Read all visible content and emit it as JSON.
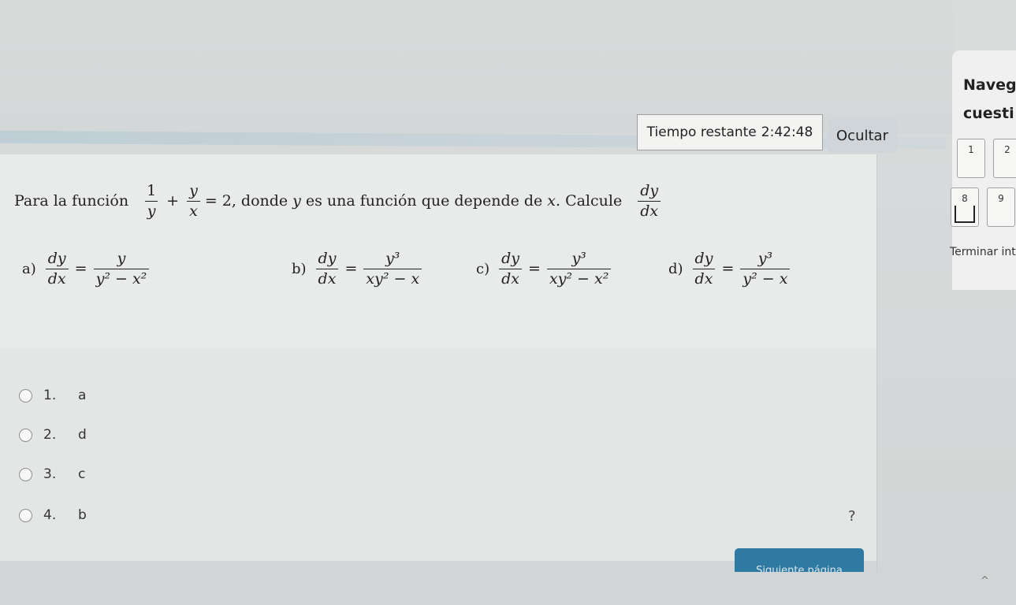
{
  "timer": {
    "label": "Tiempo restante",
    "value": "2:42:48"
  },
  "hide_button": "Ocultar",
  "question": {
    "prefix": "Para la función",
    "eq_f1_num": "1",
    "eq_f1_den": "y",
    "eq_plus": "+",
    "eq_f2_num": "y",
    "eq_f2_den": "x",
    "eq_rhs": "= 2,",
    "mid": "donde",
    "var_y": "y",
    "mid2": "es una función que depende de",
    "var_x": "x.",
    "ask": "Calcule",
    "d_num": "dy",
    "d_den": "dx"
  },
  "options": [
    {
      "label": "a)",
      "lhs_num": "dy",
      "lhs_den": "dx",
      "eq": "=",
      "rhs_num": "y",
      "rhs_den": "y² − x²"
    },
    {
      "label": "b)",
      "lhs_num": "dy",
      "lhs_den": "dx",
      "eq": "=",
      "rhs_num": "y³",
      "rhs_den": "xy² − x"
    },
    {
      "label": "c)",
      "lhs_num": "dy",
      "lhs_den": "dx",
      "eq": "=",
      "rhs_num": "y³",
      "rhs_den": "xy² − x²"
    },
    {
      "label": "d)",
      "lhs_num": "dy",
      "lhs_den": "dx",
      "eq": "=",
      "rhs_num": "y³",
      "rhs_den": "y² − x"
    }
  ],
  "answers": [
    {
      "num": "1.",
      "text": "a"
    },
    {
      "num": "2.",
      "text": "d"
    },
    {
      "num": "3.",
      "text": "c"
    },
    {
      "num": "4.",
      "text": "b"
    }
  ],
  "help_mark": "?",
  "next_button": "Siguiente página",
  "nav": {
    "title": "Navegación por el cuestionario",
    "title_line1": "Naveg",
    "title_line2": "cuesti",
    "items": [
      "1",
      "2",
      "8",
      "9"
    ],
    "finish": "Terminar intento..."
  },
  "collapse_icon": "^"
}
